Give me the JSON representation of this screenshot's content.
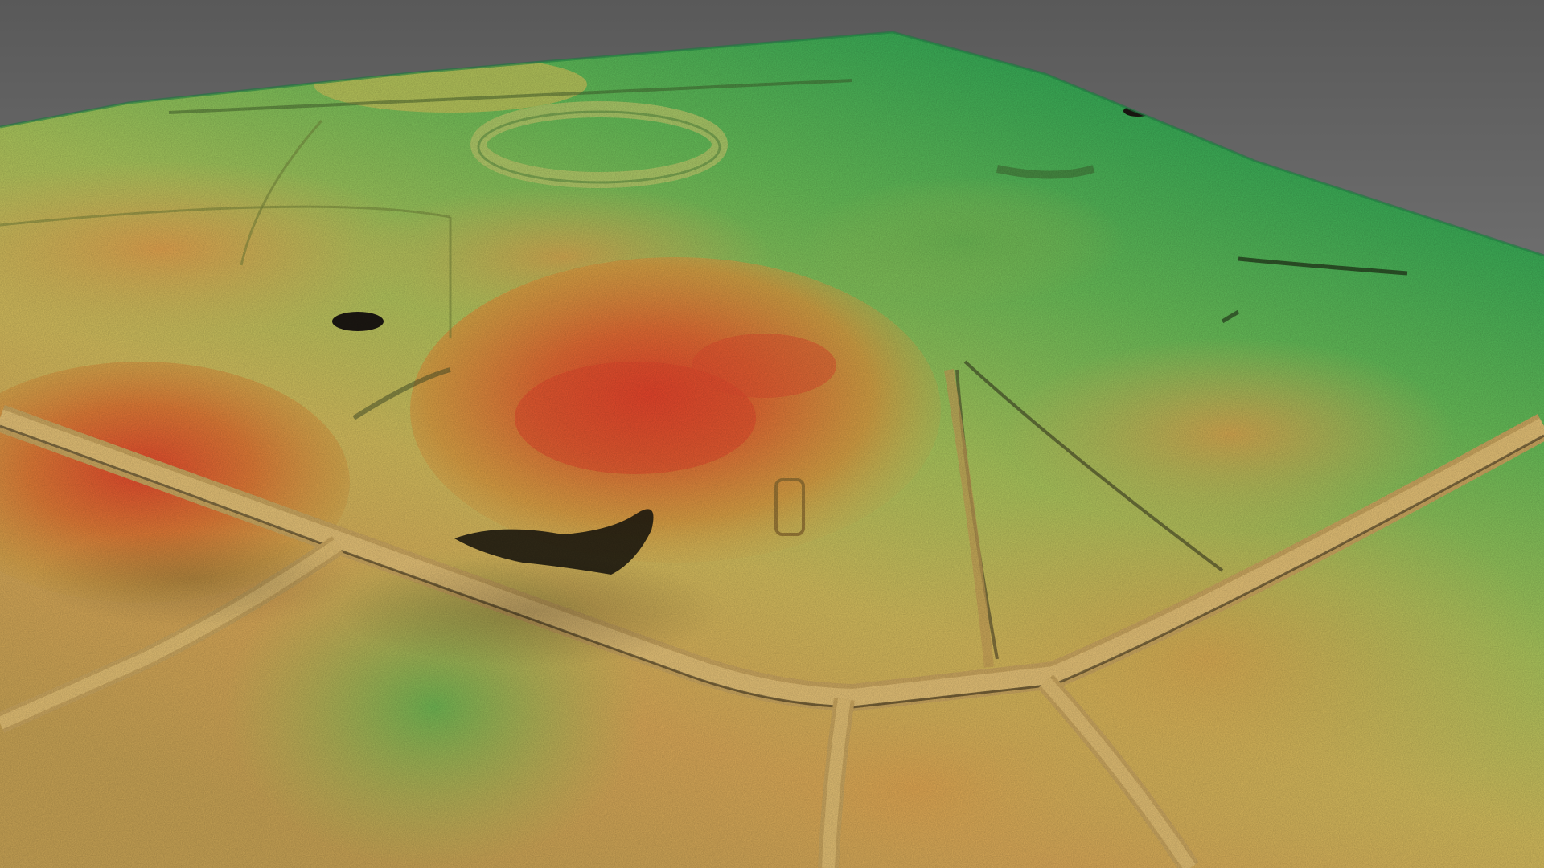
{
  "scene": {
    "kind": "lidar-terrain-3d-view",
    "colors": {
      "sky_top": "#5a5a5a",
      "sky_bottom": "#9a9a9a",
      "low_green": "#2fae5a",
      "mid_green": "#8fc655",
      "yellow_green": "#c9c35a",
      "tan": "#d7a85a",
      "orange": "#e08436",
      "red": "#e2462e",
      "road": "#d9b36a",
      "shadow": "#1d1a12"
    }
  }
}
